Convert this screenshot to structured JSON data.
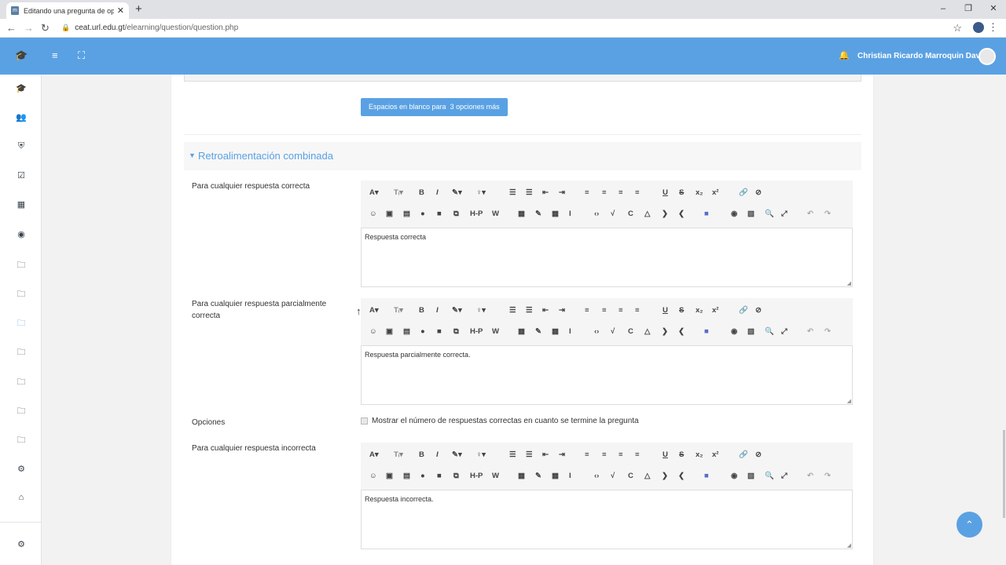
{
  "browser": {
    "tab_title": "Editando una pregunta de opció",
    "tab_close": "✕",
    "new_tab": "+",
    "url_host": "ceat.url.edu.gt",
    "url_path": "/elearning/question/question.php",
    "win_min": "–",
    "win_restore": "❐",
    "win_close": "✕"
  },
  "navbar": {
    "user_name": "Christian Ricardo Marroquin Davila"
  },
  "form": {
    "blanks_button": "Espacios en blanco para  3 opciones más",
    "section_title": "Retroalimentación combinada",
    "fields": [
      {
        "label": "Para cualquier respuesta correcta",
        "content": "Respuesta correcta"
      },
      {
        "label": "Para cualquier respuesta parcialmente correcta",
        "content": "Respuesta parcialmente correcta."
      },
      {
        "label": "Para cualquier respuesta incorrecta",
        "content": "Respuesta incorrecta."
      }
    ],
    "options_label": "Opciones",
    "options_checkbox": "Mostrar el número de respuestas correctas en cuanto se termine la pregunta"
  },
  "toolbar": {
    "font": "A▾",
    "text_size": "Tᵢ▾",
    "bold": "B",
    "italic": "I",
    "brush": "✎▾",
    "bulb": "♀▾",
    "h5p": "H-P"
  },
  "colors": {
    "brand": "#5aa1e3"
  }
}
